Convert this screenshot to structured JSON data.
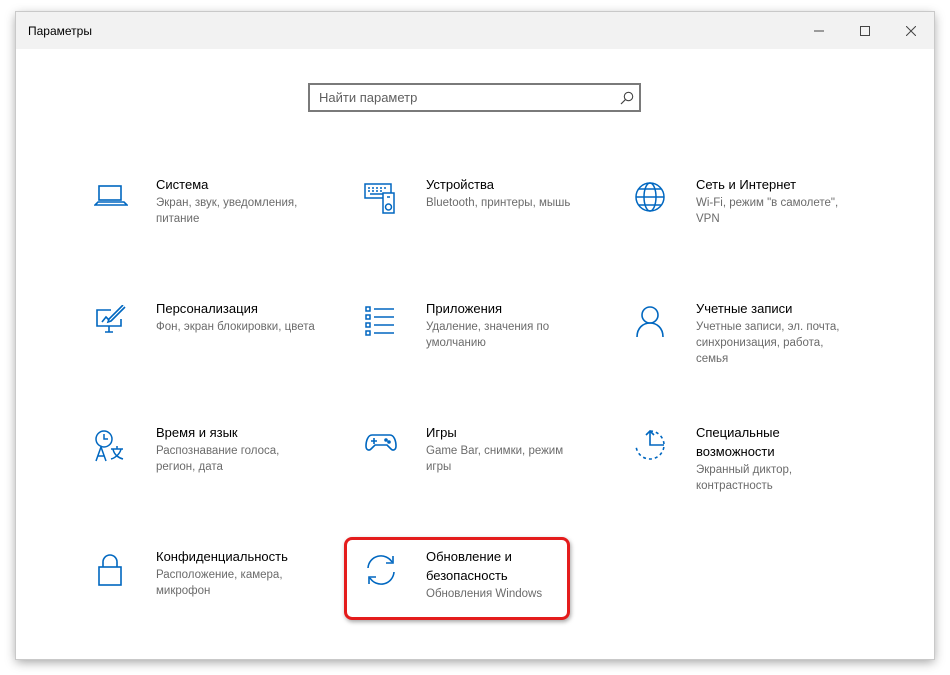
{
  "window": {
    "title": "Параметры"
  },
  "search": {
    "placeholder": "Найти параметр"
  },
  "tiles": [
    {
      "name": "Система",
      "desc": "Экран, звук, уведомления, питание",
      "icon": "laptop-icon"
    },
    {
      "name": "Устройства",
      "desc": "Bluetooth, принтеры, мышь",
      "icon": "devices-icon"
    },
    {
      "name": "Сеть и Интернет",
      "desc": "Wi-Fi, режим \"в самолете\", VPN",
      "icon": "globe-icon"
    },
    {
      "name": "Персонализация",
      "desc": "Фон, экран блокировки, цвета",
      "icon": "personalization-icon"
    },
    {
      "name": "Приложения",
      "desc": "Удаление, значения по умолчанию",
      "icon": "apps-list-icon"
    },
    {
      "name": "Учетные записи",
      "desc": "Учетные записи, эл. почта, синхронизация, работа, семья",
      "icon": "person-icon"
    },
    {
      "name": "Время и язык",
      "desc": "Распознавание голоса, регион, дата",
      "icon": "time-language-icon"
    },
    {
      "name": "Игры",
      "desc": "Game Bar, снимки, режим игры",
      "icon": "gamepad-icon"
    },
    {
      "name": "Специальные возможности",
      "desc": "Экранный диктор, контрастность",
      "icon": "accessibility-icon"
    },
    {
      "name": "Конфиденциальность",
      "desc": "Расположение, камера, микрофон",
      "icon": "lock-icon"
    },
    {
      "name": "Обновление и безопасность",
      "desc": "Обновления Windows",
      "icon": "sync-icon"
    }
  ],
  "colors": {
    "accent": "#0067c0",
    "highlight": "#e41c1c",
    "titlebar": "#f2f2f2"
  }
}
